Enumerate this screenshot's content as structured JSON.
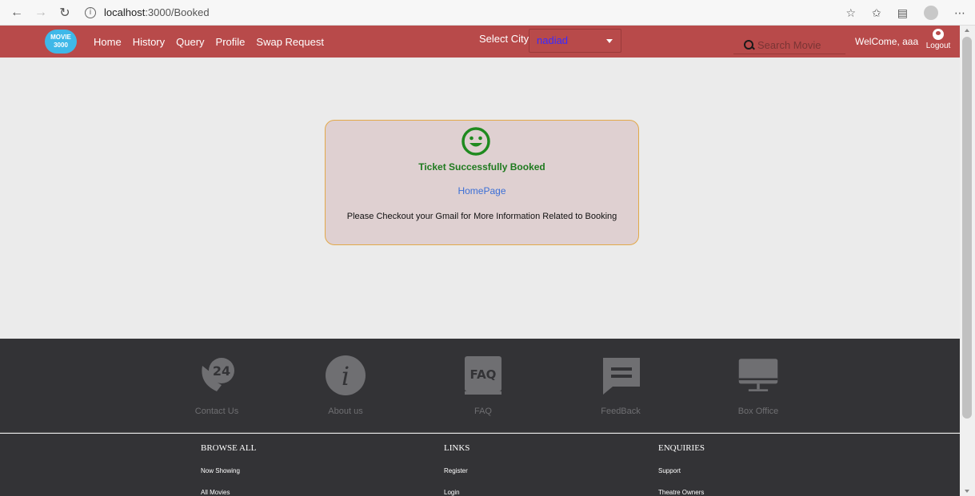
{
  "browser": {
    "url_host": "localhost",
    "url_path": ":3000/Booked"
  },
  "nav": {
    "logo_text": "MOVIE 3000",
    "links": [
      "Home",
      "History",
      "Query",
      "Profile",
      "Swap Request"
    ],
    "select_city_label": "Select City",
    "city_value": "nadiad",
    "search_placeholder": "Search Movie",
    "welcome": "WelCome, aaa",
    "logout": "Logout"
  },
  "card": {
    "title": "Ticket Successfully Booked",
    "link": "HomePage",
    "note": "Please Checkout your Gmail for More Information Related to Booking",
    "icon": "smile-icon"
  },
  "footer": {
    "items": [
      {
        "label": "Contact Us",
        "icon": "phone-24-icon"
      },
      {
        "label": "About us",
        "icon": "info-icon"
      },
      {
        "label": "FAQ",
        "icon": "faq-icon"
      },
      {
        "label": "FeedBack",
        "icon": "chat-icon"
      },
      {
        "label": "Box Office",
        "icon": "monitor-icon"
      }
    ],
    "columns": [
      {
        "heading": "BROWSE ALL",
        "items": [
          "Now Showing",
          "All Movies"
        ]
      },
      {
        "heading": "LINKS",
        "items": [
          "Register",
          "Login"
        ]
      },
      {
        "heading": "ENQUIRIES",
        "items": [
          "Support",
          "Theatre Owners"
        ]
      }
    ]
  },
  "colors": {
    "nav_bg": "#b84a4a",
    "footer_bg": "#333336",
    "success_green": "#1f7a1f",
    "link_blue": "#3b6fd6",
    "card_bg": "#dfd0d1",
    "card_border": "#e2a94a"
  }
}
